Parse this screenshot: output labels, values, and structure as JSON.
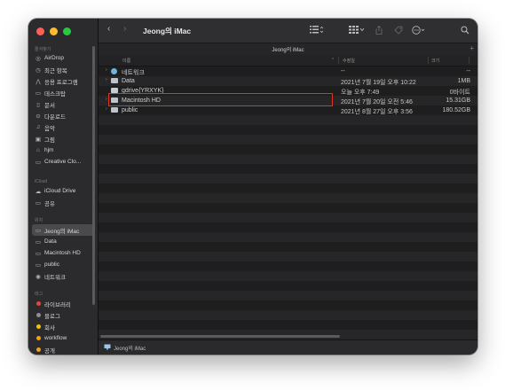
{
  "window": {
    "title": "Jeong의 iMac"
  },
  "toolbar": {
    "back_icon": "chevron-left",
    "forward_icon": "chevron-right",
    "list_view_icon": "list-icon",
    "gallery_icon": "grid-icon",
    "share_icon": "share-icon",
    "tag_icon": "tag-icon",
    "action_icon": "ellipsis-icon",
    "search_icon": "search-icon"
  },
  "tabbar": {
    "title": "Jeong의 iMac"
  },
  "columns": {
    "name": "이름",
    "date": "수정일",
    "size": "크기"
  },
  "sidebar": {
    "favorites_label": "즐겨찾기",
    "favorites": [
      {
        "label": "AirDrop",
        "icon": "airdrop-icon"
      },
      {
        "label": "최근 항목",
        "icon": "clock-icon"
      },
      {
        "label": "응용 프로그램",
        "icon": "apps-icon"
      },
      {
        "label": "데스크탑",
        "icon": "desktop-icon"
      },
      {
        "label": "문서",
        "icon": "document-icon"
      },
      {
        "label": "다운로드",
        "icon": "download-icon"
      },
      {
        "label": "음악",
        "icon": "music-icon"
      },
      {
        "label": "그림",
        "icon": "picture-icon"
      },
      {
        "label": "hjm",
        "icon": "home-icon"
      },
      {
        "label": "Creative Clo...",
        "icon": "folder-icon"
      }
    ],
    "icloud_label": "iCloud",
    "icloud": [
      {
        "label": "iCloud Drive",
        "icon": "cloud-icon"
      },
      {
        "label": "공유",
        "icon": "shared-folder-icon"
      }
    ],
    "locations_label": "위치",
    "locations": [
      {
        "label": "Jeong의 iMac",
        "icon": "computer-icon",
        "selected": true
      },
      {
        "label": "Data",
        "icon": "disk-icon"
      },
      {
        "label": "Macintosh HD",
        "icon": "disk-icon"
      },
      {
        "label": "public",
        "icon": "disk-icon"
      },
      {
        "label": "네트워크",
        "icon": "network-icon"
      }
    ],
    "tags_label": "태그",
    "tags": [
      {
        "label": "라이브러리",
        "color": "#e8453c"
      },
      {
        "label": "블로그",
        "color": "#8e8e93"
      },
      {
        "label": "회사",
        "color": "#f5c400"
      },
      {
        "label": "workflow",
        "color": "#f5a300"
      },
      {
        "label": "공개",
        "color": "#f0a020"
      }
    ]
  },
  "files": [
    {
      "name": "네트워크",
      "date": "--",
      "size": "--",
      "kind": "network"
    },
    {
      "name": "Data",
      "date": "2021년 7월 19일 오후 10:22",
      "size": "1MB",
      "kind": "disk"
    },
    {
      "name": "gdrive{YRXYK}",
      "date": "오늘 오후 7:49",
      "size": "0바이트",
      "kind": "drive"
    },
    {
      "name": "Macintosh HD",
      "date": "2021년 7월 20일 오전 5:46",
      "size": "15.31GB",
      "kind": "disk"
    },
    {
      "name": "public",
      "date": "2021년 8월 27일 오후 3:56",
      "size": "180.52GB",
      "kind": "disk"
    }
  ],
  "statusbar": {
    "path": "Jeong의 iMac"
  },
  "colors": {
    "close": "#ff5f57",
    "minimize": "#febc2e",
    "zoom": "#28c840",
    "highlight": "#e0341f"
  }
}
